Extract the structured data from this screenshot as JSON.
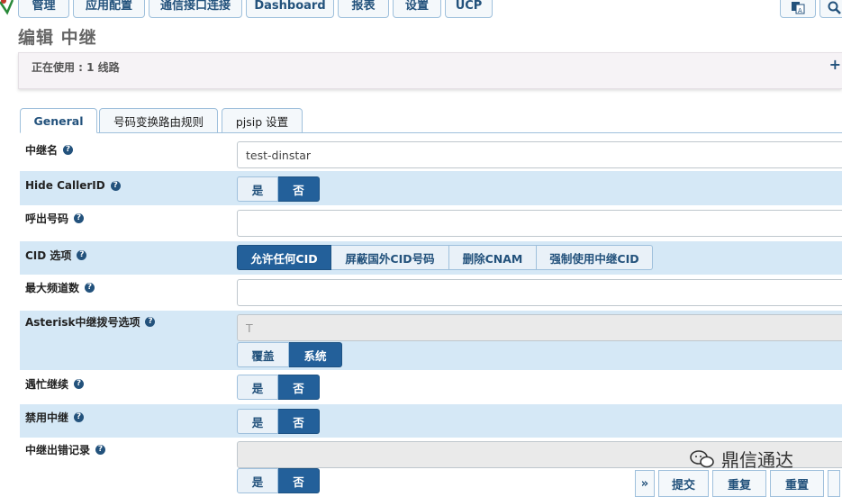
{
  "nav": {
    "items": [
      "管理",
      "应用配置",
      "通信接口连接",
      "Dashboard",
      "报表",
      "设置",
      "UCP"
    ],
    "icons": [
      "translate-icon",
      "search-icon"
    ]
  },
  "page": {
    "title": "编辑 中继",
    "in_use": "正在使用 : 1 线路",
    "add_symbol": "+"
  },
  "tabs": [
    "General",
    "号码变换路由规则",
    "pjsip 设置"
  ],
  "form": {
    "trunk_name": {
      "label": "中继名",
      "value": "test-dinstar"
    },
    "hide_callerid": {
      "label": "Hide CallerID",
      "options": [
        "是",
        "否"
      ],
      "selected": "否"
    },
    "outbound_cid": {
      "label": "呼出号码",
      "value": ""
    },
    "cid_options": {
      "label": "CID 选项",
      "options": [
        "允许任何CID",
        "屏蔽国外CID号码",
        "删除CNAM",
        "强制使用中继CID"
      ],
      "selected": "允许任何CID"
    },
    "max_channels": {
      "label": "最大频道数",
      "value": ""
    },
    "dial_options": {
      "label": "Asterisk中继拨号选项",
      "placeholder": "T",
      "options": [
        "覆盖",
        "系统"
      ],
      "selected": "系统"
    },
    "continue_busy": {
      "label": "遇忙继续",
      "options": [
        "是",
        "否"
      ],
      "selected": "否"
    },
    "disable_trunk": {
      "label": "禁用中继",
      "options": [
        "是",
        "否"
      ],
      "selected": "否"
    },
    "monitor_failures": {
      "label": "中继出错记录",
      "value": "",
      "options": [
        "是",
        "否"
      ],
      "selected": "否"
    }
  },
  "actions": {
    "expand": "»",
    "submit": "提交",
    "duplicate": "重复",
    "reset": "重置"
  },
  "watermark": "鼎信通达",
  "help_symbol": "?",
  "colors": {
    "accent": "#23609a",
    "row_alt": "#d5e8f6",
    "nav_border": "#9fc0dc"
  }
}
